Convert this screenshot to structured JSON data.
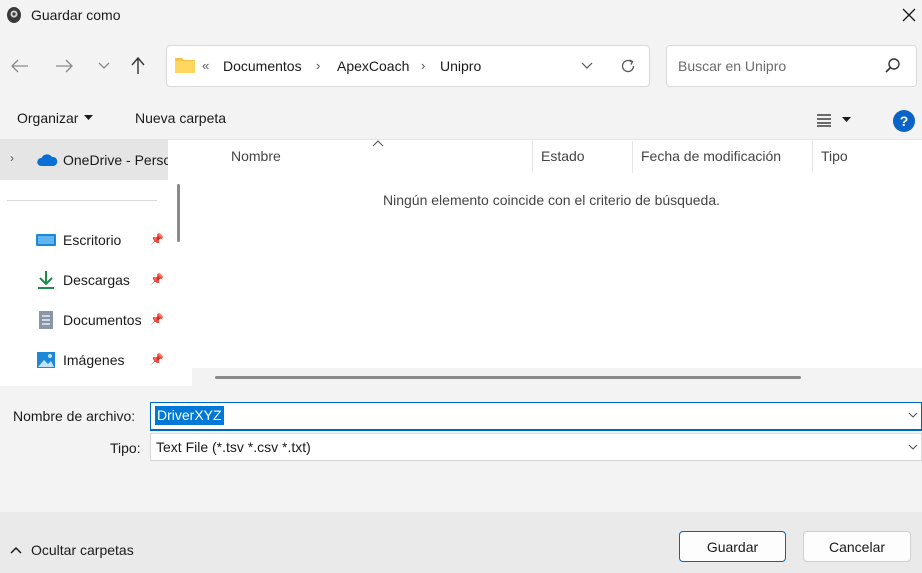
{
  "window": {
    "title": "Guardar como"
  },
  "address": {
    "overflow": "«",
    "crumbs": [
      "Documentos",
      "ApexCoach",
      "Unipro"
    ]
  },
  "search": {
    "placeholder": "Buscar en Unipro"
  },
  "toolbar": {
    "organize_label": "Organizar",
    "new_folder_label": "Nueva carpeta",
    "help_label": "?"
  },
  "sidebar": {
    "onedrive_label": "OneDrive - Personal",
    "items": [
      {
        "label": "Escritorio",
        "icon": "desktop-icon"
      },
      {
        "label": "Descargas",
        "icon": "download-icon"
      },
      {
        "label": "Documentos",
        "icon": "documents-icon"
      },
      {
        "label": "Imágenes",
        "icon": "pictures-icon"
      }
    ]
  },
  "filelist": {
    "columns": [
      "Nombre",
      "Estado",
      "Fecha de modificación",
      "Tipo"
    ],
    "empty_message": "Ningún elemento coincide con el criterio de búsqueda."
  },
  "form": {
    "filename_label": "Nombre de archivo:",
    "filename_value": "DriverXYZ",
    "type_label": "Tipo:",
    "type_value": "Text File (*.tsv *.csv *.txt)"
  },
  "footer": {
    "hide_folders_label": "Ocultar carpetas",
    "save_label": "Guardar",
    "cancel_label": "Cancelar"
  },
  "colors": {
    "accent": "#0067c0",
    "selection": "#0078d7",
    "help": "#0a63c7",
    "folder": "#f4c542",
    "onedrive": "#0a6fd6"
  }
}
